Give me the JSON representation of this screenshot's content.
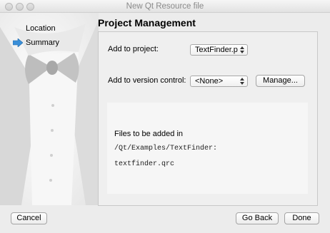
{
  "window": {
    "title": "New Qt Resource file"
  },
  "steps": [
    "Location",
    "Summary"
  ],
  "page": {
    "title": "Project Management"
  },
  "project": {
    "label": "Add to project:",
    "value": "TextFinder.p"
  },
  "version_control": {
    "label": "Add to version control:",
    "value": "<None>",
    "manage_label": "Manage..."
  },
  "files": {
    "title": "Files to be added in",
    "path": "/Qt/Examples/TextFinder:",
    "list": [
      "textfinder.qrc"
    ]
  },
  "buttons": {
    "cancel": "Cancel",
    "back": "Go Back",
    "done": "Done"
  },
  "icons": {
    "current_step": "blue-arrow-icon",
    "combo": "up-down-arrows-icon"
  },
  "colors": {
    "accent": "#3a8fd8",
    "window_bg": "#ececec"
  }
}
